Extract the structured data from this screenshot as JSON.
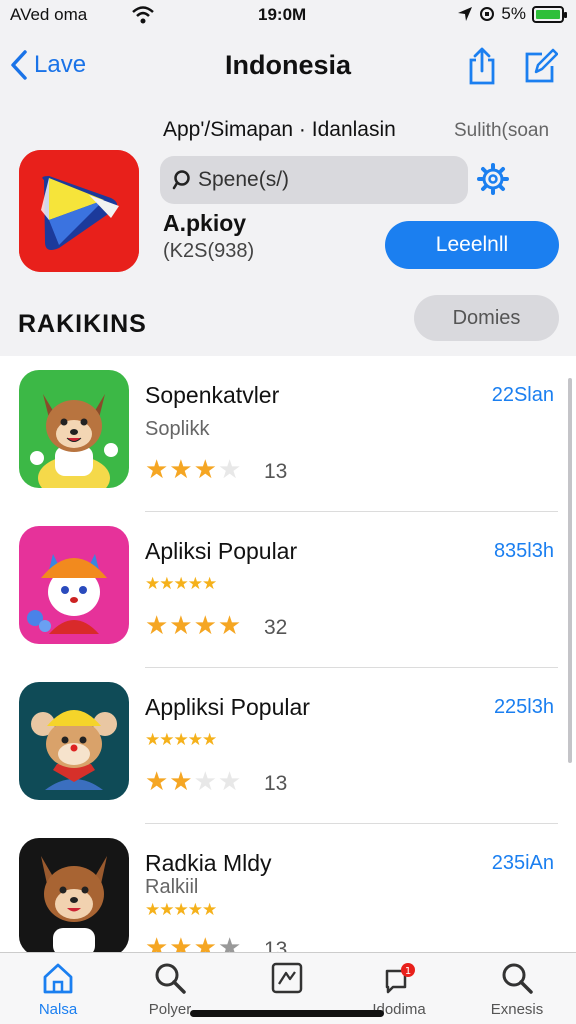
{
  "status_bar": {
    "carrier": "AVed oma",
    "time": "19:0M",
    "battery": "5%"
  },
  "nav": {
    "back_label": "Lave",
    "title": "Indonesia"
  },
  "header": {
    "line": "App'/Simapan · Idanlasin",
    "side_label": "Sulith(soan",
    "search_placeholder": "Spene(s/)",
    "app_name": "A.pkioy",
    "app_count": "(K2S(938)",
    "primary_button": "Leeelnll",
    "section_title": "RAKIKINS",
    "secondary_button": "Domies"
  },
  "rows": [
    {
      "name": "Sopenkatvler",
      "sub": "Soplikk",
      "stars_small": "",
      "rating": 3,
      "count": "13",
      "time": "22Slan"
    },
    {
      "name": "Apliksi Popular",
      "sub": "",
      "stars_small": "★★★★★",
      "rating": 4,
      "count": "32",
      "time": "835l3h"
    },
    {
      "name": "Appliksi Popular",
      "sub": "",
      "stars_small": "★★★★★",
      "rating": 2,
      "count": "13",
      "time": "225l3h"
    },
    {
      "name": "Radkia Mldy",
      "sub": "Ralkiil",
      "stars_small": "★★★★★",
      "rating": 3,
      "count": "13",
      "time": "235iAn"
    }
  ],
  "tabs": [
    {
      "label": "Nalsa",
      "icon": "home-icon"
    },
    {
      "label": "Polyer",
      "icon": "search-icon"
    },
    {
      "label": "",
      "icon": "chart-icon"
    },
    {
      "label": "Idodima",
      "icon": "notification-icon",
      "badge": "1"
    },
    {
      "label": "Exnesis",
      "icon": "search-icon"
    }
  ],
  "colors": {
    "accent": "#1b7ff0",
    "star": "#f5a623",
    "app_icon_red": "#e8201b"
  }
}
